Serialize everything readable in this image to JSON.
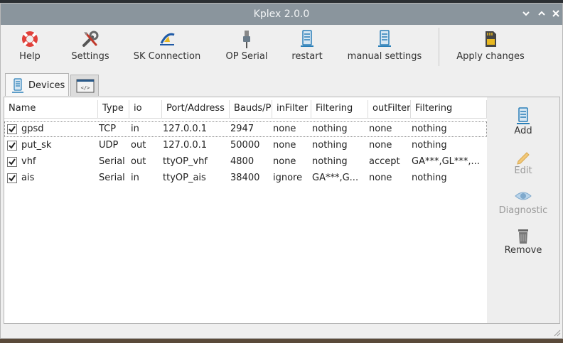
{
  "window": {
    "title": "Kplex 2.0.0"
  },
  "toolbar": {
    "help": "Help",
    "settings": "Settings",
    "sk_connection": "SK Connection",
    "op_serial": "OP Serial",
    "restart": "restart",
    "manual_settings": "manual settings",
    "apply_changes": "Apply changes"
  },
  "tabs": [
    {
      "label": "Devices",
      "icon": "device-icon"
    },
    {
      "label": "",
      "icon": "code-icon"
    }
  ],
  "table": {
    "columns": [
      "Name",
      "Type",
      "io",
      "Port/Address",
      "Bauds/P",
      "inFilter",
      "Filtering",
      "outFilter",
      "Filtering"
    ],
    "rows": [
      {
        "checked": true,
        "cells": [
          "gpsd",
          "TCP",
          "in",
          "127.0.0.1",
          "2947",
          "none",
          "nothing",
          "none",
          "nothing"
        ]
      },
      {
        "checked": true,
        "cells": [
          "put_sk",
          "UDP",
          "out",
          "127.0.0.1",
          "50000",
          "none",
          "nothing",
          "none",
          "nothing"
        ]
      },
      {
        "checked": true,
        "cells": [
          "vhf",
          "Serial",
          "out",
          "ttyOP_vhf",
          "4800",
          "none",
          "nothing",
          "accept",
          "GA***,GL***,..."
        ]
      },
      {
        "checked": true,
        "cells": [
          "ais",
          "Serial",
          "in",
          "ttyOP_ais",
          "38400",
          "ignore",
          "GA***,G...",
          "none",
          "nothing"
        ]
      }
    ]
  },
  "sidebar": {
    "add": "Add",
    "edit": "Edit",
    "diagnostic": "Diagnostic",
    "remove": "Remove"
  },
  "colors": {
    "titlebar": "#8a959d",
    "accent_blue": "#2a7fb8",
    "help_red": "#e0403a"
  }
}
